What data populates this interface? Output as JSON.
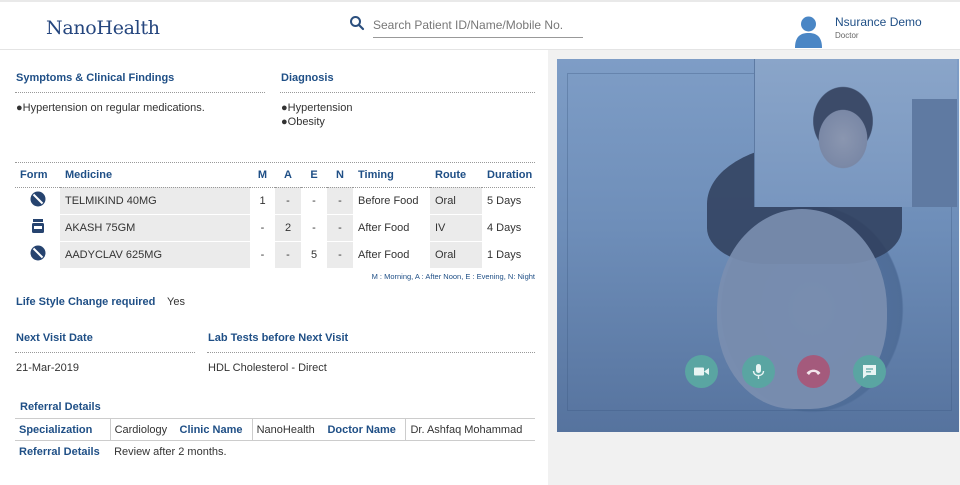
{
  "header": {
    "logo": "NanoHealth",
    "search_placeholder": "Search Patient ID/Name/Mobile No.",
    "user_name": "Nsurance Demo",
    "user_role": "Doctor"
  },
  "clinical": {
    "symptoms_title": "Symptoms & Clinical Findings",
    "symptoms": [
      "●Hypertension on regular medications."
    ],
    "diagnosis_title": "Diagnosis",
    "diagnosis": [
      "●Hypertension",
      "●Obesity"
    ]
  },
  "medicine_table": {
    "headers": [
      "Form",
      "Medicine",
      "M",
      "A",
      "E",
      "N",
      "Timing",
      "Route",
      "Duration"
    ],
    "rows": [
      {
        "form_icon": "no-entry-icon",
        "name": "TELMIKIND 40MG",
        "m": "1",
        "a": "-",
        "e": "-",
        "n": "-",
        "timing": "Before Food",
        "route": "Oral",
        "duration": "5 Days"
      },
      {
        "form_icon": "injection-vial-icon",
        "name": "AKASH 75GM",
        "m": "-",
        "a": "2",
        "e": "-",
        "n": "-",
        "timing": "After Food",
        "route": "IV",
        "duration": "4 Days"
      },
      {
        "form_icon": "no-entry-icon",
        "name": "AADYCLAV 625MG",
        "m": "-",
        "a": "-",
        "e": "5",
        "n": "-",
        "timing": "After Food",
        "route": "Oral",
        "duration": "1 Days"
      }
    ],
    "legend": "M : Morning, A : After Noon, E : Evening, N: Night"
  },
  "lifestyle": {
    "label": "Life Style Change required",
    "value": "Yes"
  },
  "next_visit": {
    "date_label": "Next Visit Date",
    "date_value": "21-Mar-2019",
    "lab_label": "Lab Tests before Next Visit",
    "lab_value": "HDL Cholesterol - Direct"
  },
  "referral": {
    "title": "Referral Details",
    "specialization_label": "Specialization",
    "specialization": "Cardiology",
    "clinic_label": "Clinic Name",
    "clinic": "NanoHealth",
    "doctor_label": "Doctor Name",
    "doctor": "Dr. Ashfaq Mohammad",
    "details_label": "Referral Details",
    "details": "Review after 2 months."
  },
  "video_call": {
    "controls": [
      "camera-icon",
      "microphone-icon",
      "end-call-icon",
      "chat-icon"
    ],
    "colors": {
      "control": "#5aa5a2",
      "end_call": "#a45a7c",
      "overlay": "#6f8fb8"
    }
  },
  "colors": {
    "brand": "#25467e",
    "label_blue": "#1f4f86"
  }
}
